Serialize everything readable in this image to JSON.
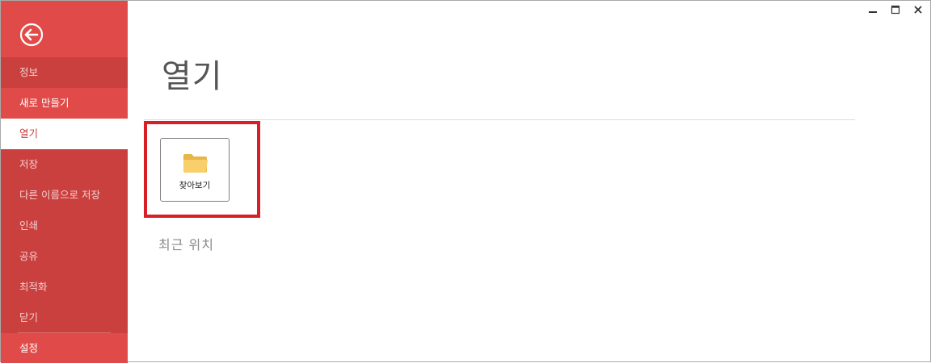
{
  "sidebar": {
    "back_icon": "back-arrow-icon",
    "items": [
      {
        "label": "정보",
        "style": "dim"
      },
      {
        "label": "새로 만들기",
        "style": "bright"
      },
      {
        "label": "열기",
        "style": "selected"
      },
      {
        "label": "저장",
        "style": "dim"
      },
      {
        "label": "다른 이름으로 저장",
        "style": "dim"
      },
      {
        "label": "인쇄",
        "style": "dim"
      },
      {
        "label": "공유",
        "style": "dim"
      },
      {
        "label": "최적화",
        "style": "dim"
      },
      {
        "label": "닫기",
        "style": "dim"
      }
    ],
    "settings_label": "설정"
  },
  "window_controls": [
    "minimize-icon",
    "maximize-icon",
    "close-icon"
  ],
  "main": {
    "title": "열기",
    "browse_label": "찾아보기",
    "browse_icon": "folder-icon",
    "recent_heading": "최근 위치"
  },
  "colors": {
    "sidebar_dark": "#c9403f",
    "sidebar_bright": "#e04b49",
    "highlight": "#d81f28"
  }
}
